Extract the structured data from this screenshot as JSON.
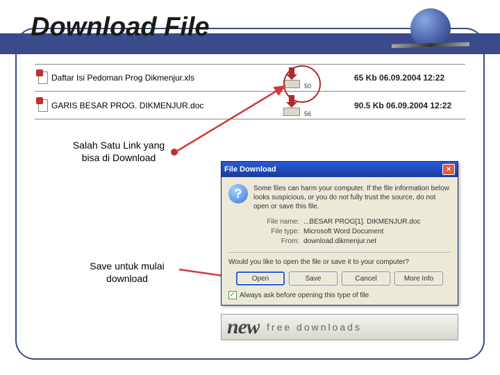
{
  "title": "Download File",
  "files": [
    {
      "name": "Daftar Isi Pedoman Prog Dikmenjur.xls",
      "count": "50",
      "size": "65 Kb",
      "date": "06.09.2004 12:22"
    },
    {
      "name": "GARIS BESAR PROG. DIKMENJUR.doc",
      "count": "56",
      "size": "90.5 Kb",
      "date": "06.09.2004 12:22"
    }
  ],
  "captions": {
    "link": "Salah Satu Link yang bisa di Download",
    "save": "Save untuk mulai download"
  },
  "dialog": {
    "title": "File Download",
    "warning": "Some files can harm your computer. If the file information below looks suspicious, or you do not fully trust the source, do not open or save this file.",
    "labels": {
      "filename": "File name:",
      "filetype": "File type:",
      "from": "From:"
    },
    "filename": "...BESAR PROG[1]. DIKMENJUR.doc",
    "filetype": "Microsoft Word Document",
    "from": "download.dikmenjur.net",
    "prompt": "Would you like to open the file or save it to your computer?",
    "buttons": {
      "open": "Open",
      "save": "Save",
      "cancel": "Cancel",
      "more": "More Info"
    },
    "checkbox": "Always ask before opening this type of file"
  },
  "banner": {
    "brand": "new",
    "tagline": "free downloads"
  }
}
